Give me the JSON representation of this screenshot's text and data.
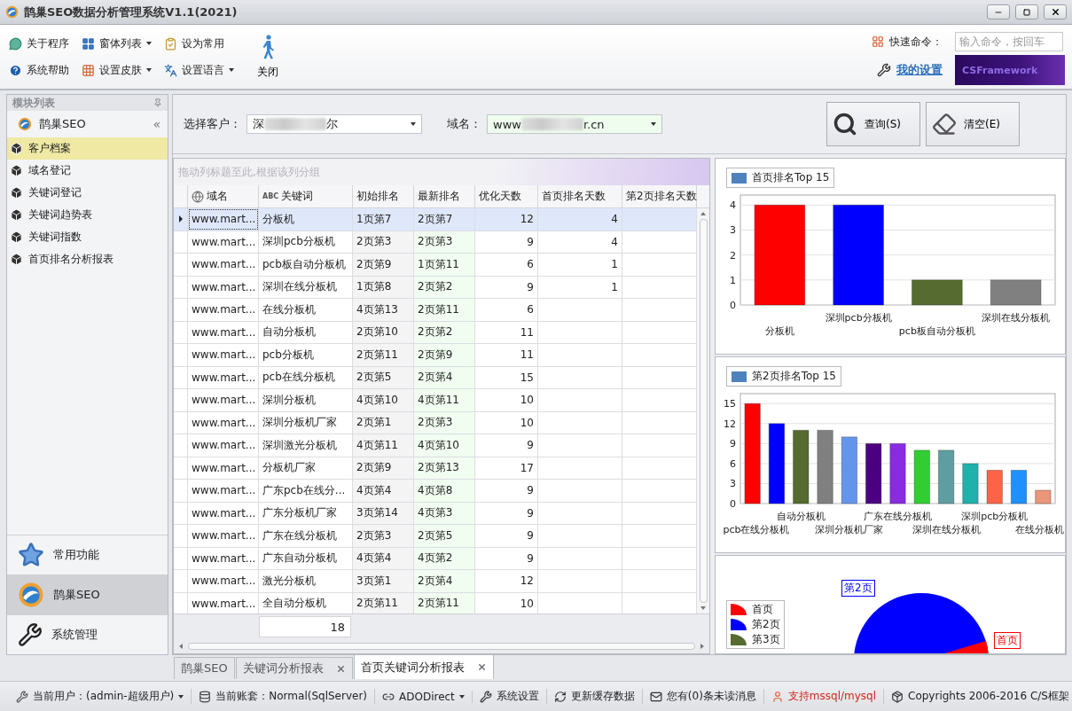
{
  "window": {
    "title": "鹊巢SEO数据分析管理系统V1.1(2021)"
  },
  "ribbon": {
    "items": [
      {
        "label": "关于程序",
        "kind": "about",
        "dropdown": false
      },
      {
        "label": "系统帮助",
        "kind": "help",
        "dropdown": false
      },
      {
        "label": "窗体列表",
        "kind": "windows",
        "dropdown": true
      },
      {
        "label": "设置皮肤",
        "kind": "skin",
        "dropdown": true
      },
      {
        "label": "设为常用",
        "kind": "favorite",
        "dropdown": false
      },
      {
        "label": "设置语言",
        "kind": "language",
        "dropdown": true
      }
    ],
    "close_button": "关闭",
    "quick_command": {
      "label": "快速命令：",
      "placeholder": "输入命令，按回车"
    },
    "my_settings": "我的设置",
    "banner": "CSFramework"
  },
  "sidebar": {
    "title": "模块列表",
    "group": "鹊巢SEO",
    "collapse_glyph": "«",
    "items": [
      {
        "label": "客户档案",
        "selected": true
      },
      {
        "label": "域名登记",
        "selected": false
      },
      {
        "label": "关键词登记",
        "selected": false
      },
      {
        "label": "关键词趋势表",
        "selected": false
      },
      {
        "label": "关键词指数",
        "selected": false
      },
      {
        "label": "首页排名分析报表",
        "selected": false
      }
    ],
    "nav": [
      {
        "label": "常用功能",
        "kind": "star",
        "selected": false
      },
      {
        "label": "鹊巢SEO",
        "kind": "logo",
        "selected": true
      },
      {
        "label": "系统管理",
        "kind": "tools",
        "selected": false
      }
    ]
  },
  "filter": {
    "customer": {
      "label": "选择客户：",
      "value_start": "深",
      "value_end": "尔"
    },
    "domain": {
      "label": "域名：",
      "value_start": "www",
      "value_end": "r.cn"
    },
    "buttons": [
      {
        "label": "查询(S)",
        "kind": "search"
      },
      {
        "label": "清空(E)",
        "kind": "clear"
      }
    ]
  },
  "grid": {
    "group_hint": "拖动列标题至此,根据该列分组",
    "columns": [
      {
        "label": "域名",
        "kind": "globe"
      },
      {
        "label": "关键词",
        "kind": "text",
        "badge": "ABC"
      },
      {
        "label": "初始排名",
        "kind": "plain"
      },
      {
        "label": "最新排名",
        "kind": "plain"
      },
      {
        "label": "优化天数",
        "kind": "plain"
      },
      {
        "label": "首页排名天数",
        "kind": "plain"
      },
      {
        "label": "第2页排名天数",
        "kind": "plain"
      }
    ],
    "rows": [
      {
        "selected": true,
        "cells": [
          "www.mart...",
          "分板机",
          "1页第7",
          "2页第7",
          "12",
          "4",
          null
        ]
      },
      {
        "selected": false,
        "cells": [
          "www.mart...",
          "深圳pcb分板机",
          "2页第3",
          "2页第3",
          "9",
          "4",
          null
        ]
      },
      {
        "selected": false,
        "cells": [
          "www.mart...",
          "pcb板自动分板机",
          "2页第9",
          "1页第11",
          "6",
          "1",
          null
        ]
      },
      {
        "selected": false,
        "cells": [
          "www.mart...",
          "深圳在线分板机",
          "1页第8",
          "2页第2",
          "9",
          "1",
          null
        ]
      },
      {
        "selected": false,
        "cells": [
          "www.mart...",
          "在线分板机",
          "4页第13",
          "2页第11",
          "6",
          null,
          null
        ]
      },
      {
        "selected": false,
        "cells": [
          "www.mart...",
          "自动分板机",
          "2页第10",
          "2页第2",
          "11",
          null,
          null
        ]
      },
      {
        "selected": false,
        "cells": [
          "www.mart...",
          "pcb分板机",
          "2页第11",
          "2页第9",
          "11",
          null,
          null
        ]
      },
      {
        "selected": false,
        "cells": [
          "www.mart...",
          "pcb在线分板机",
          "2页第5",
          "2页第4",
          "15",
          null,
          null
        ]
      },
      {
        "selected": false,
        "cells": [
          "www.mart...",
          "深圳分板机",
          "4页第10",
          "4页第11",
          "10",
          null,
          null
        ]
      },
      {
        "selected": false,
        "cells": [
          "www.mart...",
          "深圳分板机厂家",
          "2页第1",
          "2页第3",
          "10",
          null,
          null
        ]
      },
      {
        "selected": false,
        "cells": [
          "www.mart...",
          "深圳激光分板机",
          "4页第11",
          "4页第10",
          "9",
          null,
          null
        ]
      },
      {
        "selected": false,
        "cells": [
          "www.mart...",
          "分板机厂家",
          "2页第9",
          "2页第13",
          "17",
          null,
          null
        ]
      },
      {
        "selected": false,
        "cells": [
          "www.mart...",
          "广东pcb在线分...",
          "4页第4",
          "4页第8",
          "9",
          null,
          null
        ]
      },
      {
        "selected": false,
        "cells": [
          "www.mart...",
          "广东分板机厂家",
          "3页第14",
          "4页第3",
          "9",
          null,
          null
        ]
      },
      {
        "selected": false,
        "cells": [
          "www.mart...",
          "广东在线分板机",
          "2页第3",
          "2页第5",
          "9",
          null,
          null
        ]
      },
      {
        "selected": false,
        "cells": [
          "www.mart...",
          "广东自动分板机",
          "4页第4",
          "4页第2",
          "9",
          null,
          null
        ]
      },
      {
        "selected": false,
        "cells": [
          "www.mart...",
          "激光分板机",
          "3页第1",
          "2页第4",
          "12",
          null,
          null
        ]
      },
      {
        "selected": false,
        "cells": [
          "www.mart...",
          "全自动分板机",
          "2页第11",
          "2页第11",
          "10",
          null,
          null
        ]
      }
    ],
    "footer_count": "18"
  },
  "charts": [
    {
      "chart_data": {
        "type": "bar",
        "grid": true,
        "categories": [
          "分板机",
          "深圳pcb分板机",
          "pcb板自动分板机",
          "深圳在线分板机"
        ],
        "series": [
          {
            "name": "首页排名Top 15",
            "values": [
              4,
              4,
              1,
              1
            ]
          }
        ],
        "colors": [
          "#ff0000",
          "#0000ff",
          "#556b2f",
          "#808080"
        ],
        "ylim": [
          0,
          4.4
        ],
        "yticks": [
          0,
          1,
          2,
          3,
          4
        ]
      }
    },
    {
      "chart_data": {
        "type": "bar",
        "grid": true,
        "categories": [
          "pcb在线分板机",
          null,
          "自动分板机",
          null,
          "深圳分板机厂家",
          null,
          "广东在线分板机",
          null,
          "深圳在线分板机",
          null,
          "深圳pcb分板机",
          null,
          "在线分板机"
        ],
        "series": [
          {
            "name": "第2页排名Top 15",
            "values": [
              15,
              12,
              11,
              11,
              10,
              9,
              9,
              8,
              8,
              6,
              5,
              5,
              2
            ]
          }
        ],
        "colors": [
          "#ff0000",
          "#0000ff",
          "#556b2f",
          "#808080",
          "#6495ed",
          "#4b0082",
          "#8a2be2",
          "#32cd32",
          "#5f9ea0",
          "#20b2aa",
          "#ff6347",
          "#1e90ff",
          "#e9967a"
        ],
        "ylim": [
          0,
          16.5
        ],
        "yticks": [
          0,
          3,
          6,
          9,
          12,
          15
        ]
      }
    }
  ],
  "pie": {
    "legend": [
      {
        "label": "首页",
        "color": "#ff0000"
      },
      {
        "label": "第2页",
        "color": "#0000ff"
      },
      {
        "label": "第3页",
        "color": "#556b2f"
      }
    ],
    "labels": [
      {
        "label": "第2页",
        "color": "#0000ff"
      },
      {
        "label": "首页",
        "color": "#ff0000"
      }
    ]
  },
  "tabs": [
    {
      "label": "鹊巢SEO",
      "closable": false,
      "selected": false
    },
    {
      "label": "关键词分析报表",
      "closable": true,
      "selected": false
    },
    {
      "label": "首页关键词分析报表",
      "closable": true,
      "selected": true
    }
  ],
  "status_bar": [
    {
      "label": "当前用户：(admin-超级用户)",
      "kind": "user",
      "dropdown": true
    },
    {
      "label": "当前账套：Normal(SqlServer)",
      "kind": "db",
      "dropdown": false
    },
    {
      "label": "ADODirect",
      "kind": "link",
      "dropdown": true
    },
    {
      "label": "系统设置",
      "kind": "tools",
      "dropdown": false
    },
    {
      "label": "更新缓存数据",
      "kind": "refresh",
      "dropdown": false
    },
    {
      "label": "您有(0)条未读消息",
      "kind": "mail",
      "dropdown": false
    },
    {
      "label": "支持mssql/mysql",
      "kind": "support",
      "dropdown": false
    },
    {
      "label": "Copyrights 2006-2016 C/S框架",
      "kind": "box",
      "dropdown": false
    }
  ]
}
